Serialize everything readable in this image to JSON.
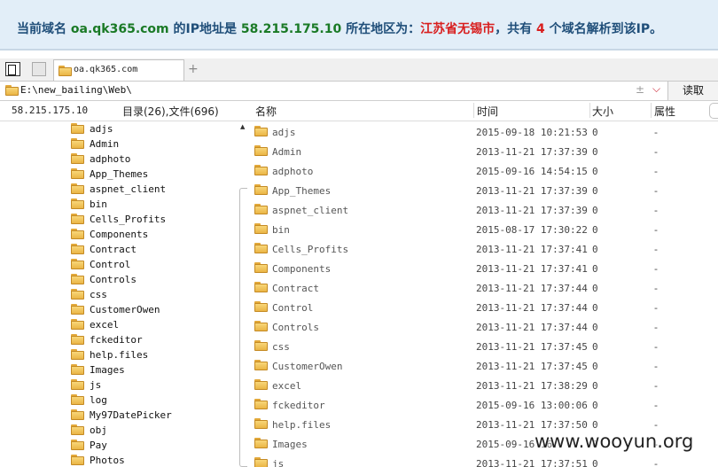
{
  "banner": {
    "prefix": "当前域名 ",
    "domain": "oa.qk365.com",
    "ip_prefix": " 的IP地址是 ",
    "ip": "58.215.175.10",
    "loc_prefix": " 所在地区为：",
    "location": "江苏省无锡市",
    "count_prefix": "，共有 ",
    "count": "4",
    "suffix": " 个域名解析到该IP。"
  },
  "tab": {
    "label": "oa.qk365.com"
  },
  "new_tab": "+",
  "path": {
    "value": "E:\\new_bailing\\Web\\",
    "plusminus": "±",
    "chevron": "⌵",
    "read_button": "读取"
  },
  "left": {
    "ip": "58.215.175.10",
    "stats": "目录(26),文件(696)",
    "scroll_up": "▲"
  },
  "columns": {
    "name": "名称",
    "time": "时间",
    "size": "大小",
    "attr": "属性"
  },
  "tree": [
    "adjs",
    "Admin",
    "adphoto",
    "App_Themes",
    "aspnet_client",
    "bin",
    "Cells_Profits",
    "Components",
    "Contract",
    "Control",
    "Controls",
    "css",
    "CustomerOwen",
    "excel",
    "fckeditor",
    "help.files",
    "Images",
    "js",
    "log",
    "My97DatePicker",
    "obj",
    "Pay",
    "Photos"
  ],
  "files": [
    {
      "name": "adjs",
      "time": "2015-09-18 10:21:53",
      "size": "0",
      "attr": "-"
    },
    {
      "name": "Admin",
      "time": "2013-11-21 17:37:39",
      "size": "0",
      "attr": "-"
    },
    {
      "name": "adphoto",
      "time": "2015-09-16 14:54:15",
      "size": "0",
      "attr": "-"
    },
    {
      "name": "App_Themes",
      "time": "2013-11-21 17:37:39",
      "size": "0",
      "attr": "-"
    },
    {
      "name": "aspnet_client",
      "time": "2013-11-21 17:37:39",
      "size": "0",
      "attr": "-"
    },
    {
      "name": "bin",
      "time": "2015-08-17 17:30:22",
      "size": "0",
      "attr": "-"
    },
    {
      "name": "Cells_Profits",
      "time": "2013-11-21 17:37:41",
      "size": "0",
      "attr": "-"
    },
    {
      "name": "Components",
      "time": "2013-11-21 17:37:41",
      "size": "0",
      "attr": "-"
    },
    {
      "name": "Contract",
      "time": "2013-11-21 17:37:44",
      "size": "0",
      "attr": "-"
    },
    {
      "name": "Control",
      "time": "2013-11-21 17:37:44",
      "size": "0",
      "attr": "-"
    },
    {
      "name": "Controls",
      "time": "2013-11-21 17:37:44",
      "size": "0",
      "attr": "-"
    },
    {
      "name": "css",
      "time": "2013-11-21 17:37:45",
      "size": "0",
      "attr": "-"
    },
    {
      "name": "CustomerOwen",
      "time": "2013-11-21 17:37:45",
      "size": "0",
      "attr": "-"
    },
    {
      "name": "excel",
      "time": "2013-11-21 17:38:29",
      "size": "0",
      "attr": "-"
    },
    {
      "name": "fckeditor",
      "time": "2015-09-16 13:00:06",
      "size": "0",
      "attr": "-"
    },
    {
      "name": "help.files",
      "time": "2013-11-21 17:37:50",
      "size": "0",
      "attr": "-"
    },
    {
      "name": "Images",
      "time": "2015-09-16 16:",
      "size": "0",
      "attr": "-"
    },
    {
      "name": "js",
      "time": "2013-11-21 17:37:51",
      "size": "0",
      "attr": "-"
    }
  ],
  "watermark": "www.wooyun.org"
}
